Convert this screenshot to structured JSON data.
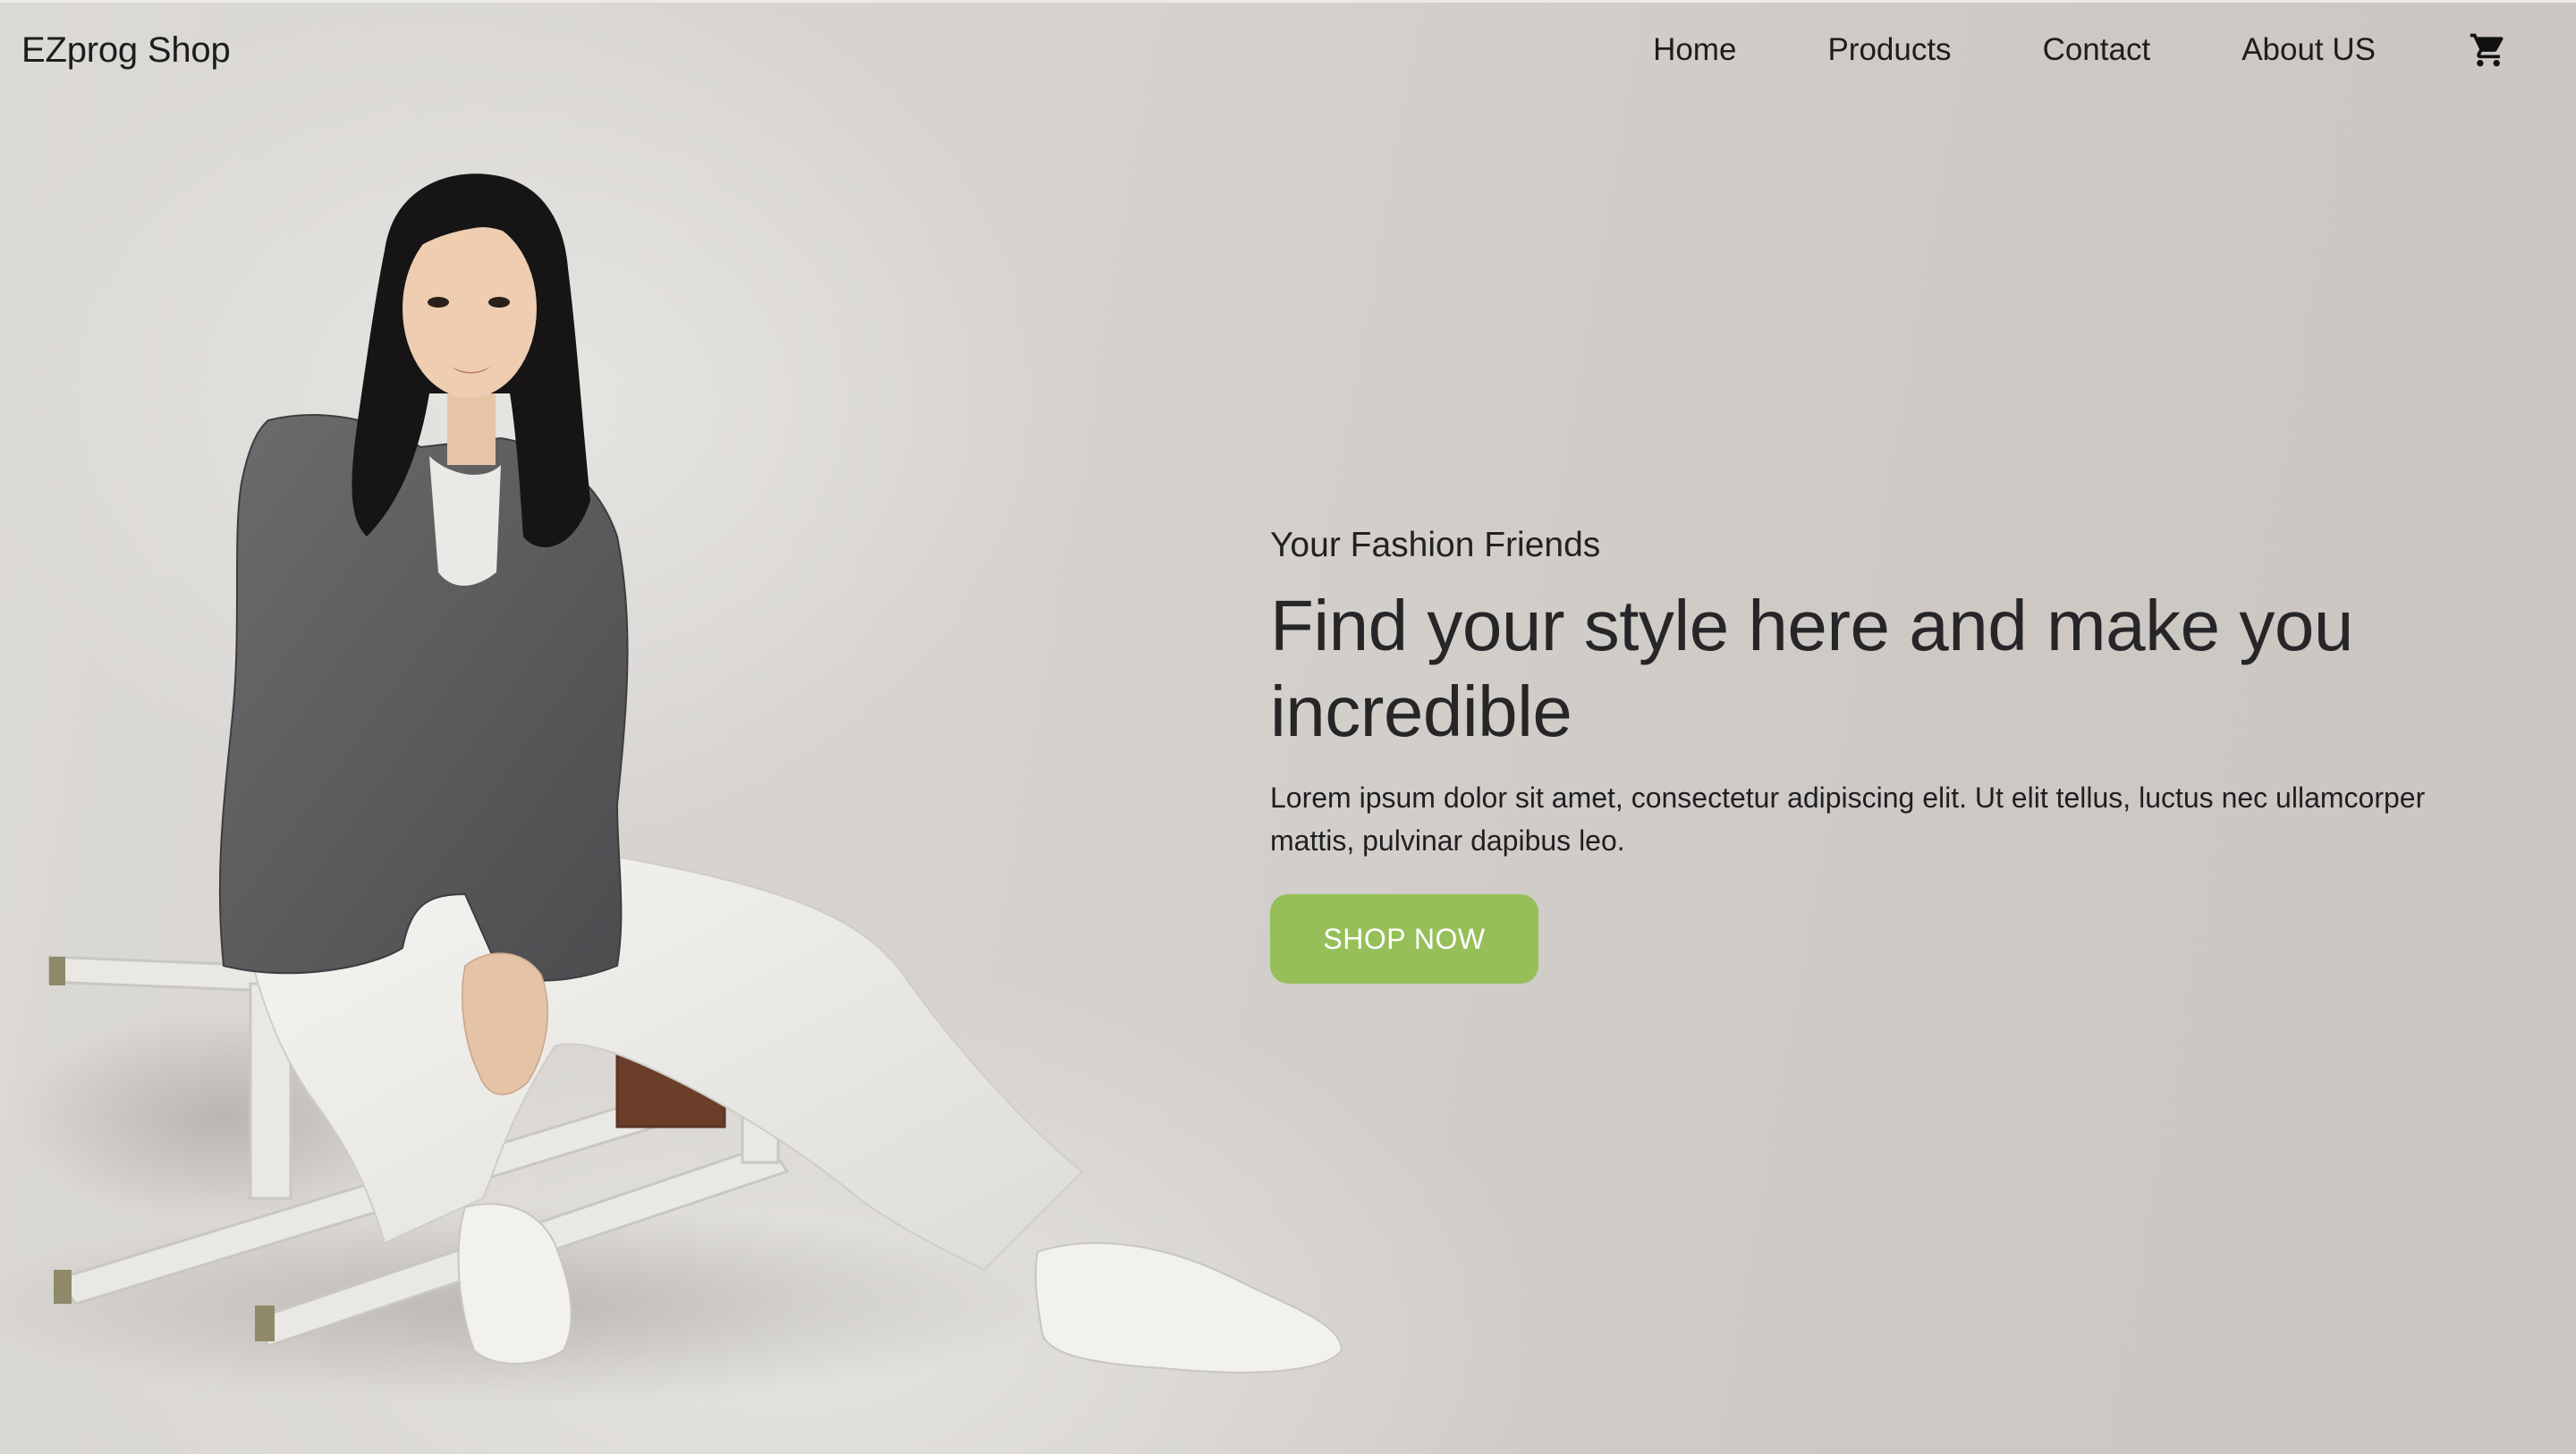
{
  "navbar": {
    "brand": "EZprog Shop",
    "links": [
      "Home",
      "Products",
      "Contact",
      "About US"
    ],
    "cart_icon": "cart-icon"
  },
  "hero": {
    "eyebrow": "Your Fashion Friends",
    "headline": "Find your style here and make you incredible",
    "lead": "Lorem ipsum dolor sit amet, consectetur adipiscing elit. Ut elit tellus, luctus nec ullamcorper mattis, pulvinar dapibus leo.",
    "button_label": "SHOP NOW"
  },
  "colors": {
    "accent": "#96bf5a",
    "text": "#252527",
    "background": "#cfcbc7"
  }
}
